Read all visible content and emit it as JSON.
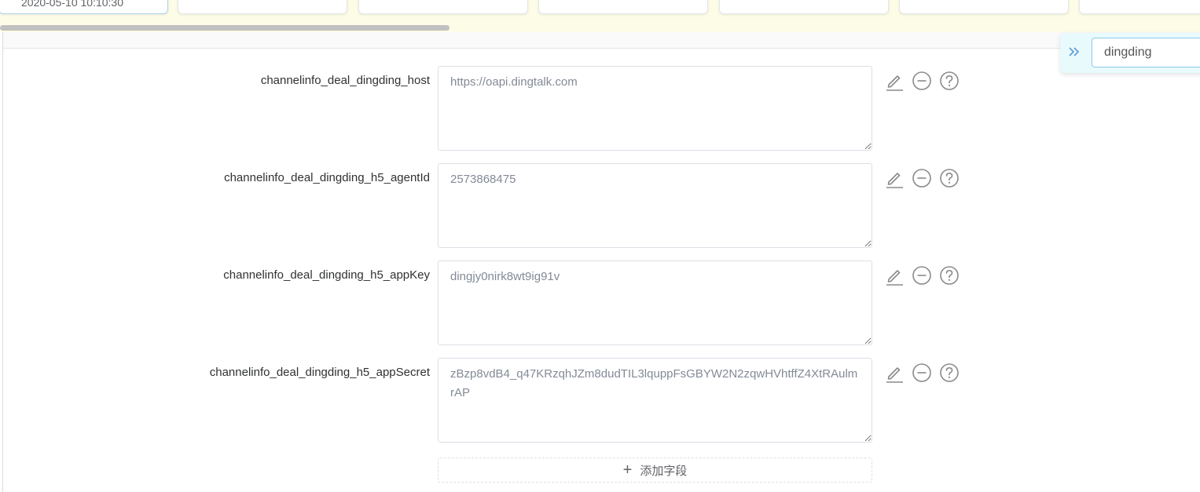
{
  "tabs": [
    {
      "label": "2020-05-10 10:10:30"
    },
    {
      "label": ""
    },
    {
      "label": ""
    },
    {
      "label": ""
    },
    {
      "label": ""
    },
    {
      "label": ""
    },
    {
      "label": ""
    }
  ],
  "search": {
    "value": "dingding",
    "placeholder": ""
  },
  "fields": [
    {
      "key": "channelinfo_deal_dingding_host",
      "value": "https://oapi.dingtalk.com"
    },
    {
      "key": "channelinfo_deal_dingding_h5_agentId",
      "value": "2573868475"
    },
    {
      "key": "channelinfo_deal_dingding_h5_appKey",
      "value": "dingjy0nirk8wt9ig91v"
    },
    {
      "key": "channelinfo_deal_dingding_h5_appSecret",
      "value": "zBzp8vdB4_q47KRzqhJZm8dudTIL3lquppFsGBYW2N2zqwHVhtffZ4XtRAulmrAP"
    }
  ],
  "add_field": {
    "label": "添加字段"
  },
  "icons": {
    "edit": "edit-icon",
    "remove": "minus-circle-icon",
    "help": "question-circle-icon",
    "expand": "double-chevron-right-icon"
  },
  "colors": {
    "icon": "#8a8a8a",
    "search_border": "#8cc8e8",
    "top_strip": "#fdfce6"
  }
}
